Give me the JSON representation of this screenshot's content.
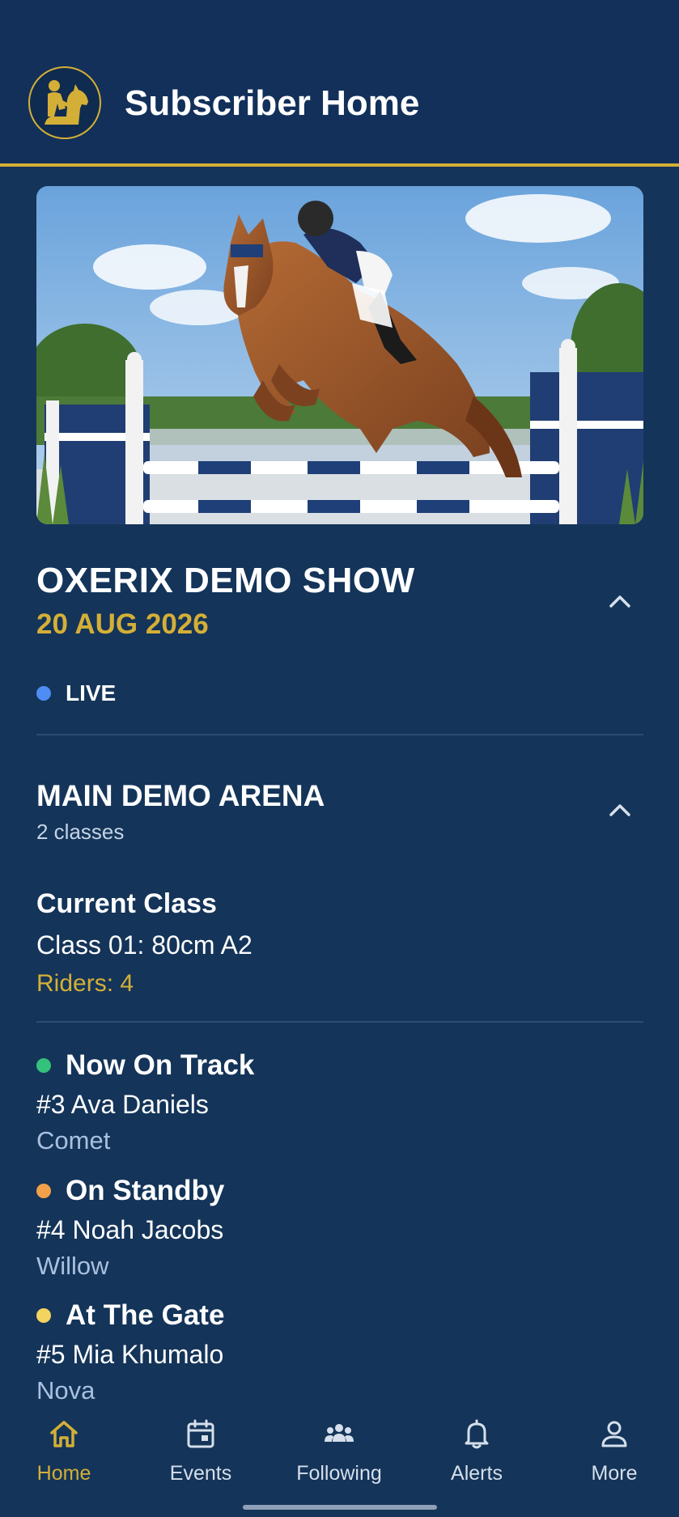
{
  "header": {
    "title": "Subscriber Home",
    "logo_icon": "horse-rider-logo-icon"
  },
  "colors": {
    "background": "#143459",
    "accent_gold": "#d4af37",
    "live_blue": "#4f8df5",
    "status_green": "#34c17b",
    "status_orange": "#f2a14a",
    "status_yellow": "#f4d35e"
  },
  "hero": {
    "image": "show-jumping-horse-photo"
  },
  "show": {
    "title": "OXERIX DEMO SHOW",
    "date": "20 AUG 2026",
    "status": "LIVE",
    "expanded": true
  },
  "arena": {
    "title": "MAIN DEMO ARENA",
    "class_count": "2 classes",
    "expanded": true,
    "current_class": {
      "heading": "Current Class",
      "name": "Class 01: 80cm A2",
      "riders": "Riders: 4"
    }
  },
  "track": [
    {
      "status": "Now On Track",
      "rider": "#3 Ava Daniels",
      "horse": "Comet",
      "color": "#34c17b"
    },
    {
      "status": "On Standby",
      "rider": "#4 Noah Jacobs",
      "horse": "Willow",
      "color": "#f2a14a"
    },
    {
      "status": "At The Gate",
      "rider": "#5 Mia Khumalo",
      "horse": "Nova",
      "color": "#f4d35e"
    }
  ],
  "nav": {
    "active": "Home",
    "items": [
      {
        "label": "Home",
        "icon": "home-icon"
      },
      {
        "label": "Events",
        "icon": "calendar-icon"
      },
      {
        "label": "Following",
        "icon": "people-icon"
      },
      {
        "label": "Alerts",
        "icon": "bell-icon"
      },
      {
        "label": "More",
        "icon": "person-icon"
      }
    ]
  }
}
